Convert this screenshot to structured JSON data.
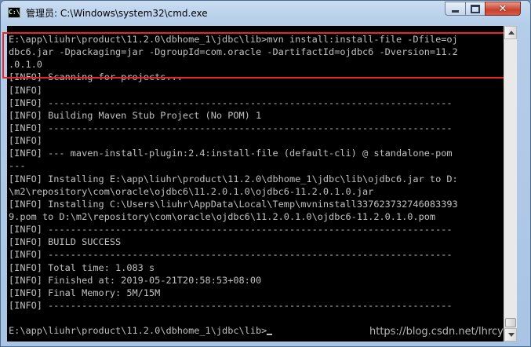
{
  "window": {
    "title": "管理员: C:\\Windows\\system32\\cmd.exe",
    "app_icon": "C:\\"
  },
  "console": {
    "lines": [
      "E:\\app\\liuhr\\product\\11.2.0\\dbhome_1\\jdbc\\lib>mvn install:install-file -Dfile=oj",
      "dbc6.jar -Dpackaging=jar -DgroupId=com.oracle -DartifactId=ojdbc6 -Dversion=11.2",
      ".0.1.0",
      "[INFO] Scanning for projects...",
      "[INFO]",
      "[INFO] ------------------------------------------------------------------------",
      "[INFO] Building Maven Stub Project (No POM) 1",
      "[INFO] ------------------------------------------------------------------------",
      "[INFO]",
      "[INFO] --- maven-install-plugin:2.4:install-file (default-cli) @ standalone-pom",
      "---",
      "[INFO] Installing E:\\app\\liuhr\\product\\11.2.0\\dbhome_1\\jdbc\\lib\\ojdbc6.jar to D:",
      "\\m2\\repository\\com\\oracle\\ojdbc6\\11.2.0.1.0\\ojdbc6-11.2.0.1.0.jar",
      "[INFO] Installing C:\\Users\\liuhr\\AppData\\Local\\Temp\\mvninstall337623732746083393",
      "9.pom to D:\\m2\\repository\\com\\oracle\\ojdbc6\\11.2.0.1.0\\ojdbc6-11.2.0.1.0.pom",
      "[INFO] ------------------------------------------------------------------------",
      "[INFO] BUILD SUCCESS",
      "[INFO] ------------------------------------------------------------------------",
      "[INFO] Total time: 1.083 s",
      "[INFO] Finished at: 2019-05-21T20:58:53+08:00",
      "[INFO] Final Memory: 5M/15M",
      "[INFO] ------------------------------------------------------------------------",
      "",
      "E:\\app\\liuhr\\product\\11.2.0\\dbhome_1\\jdbc\\lib>"
    ]
  },
  "watermark": "https://blog.csdn.net/lhrcy",
  "colors": {
    "console_bg": "#000000",
    "console_text": "#c0c0c0",
    "highlight_border": "#e8262a",
    "close_button": "#c8412e"
  },
  "icons": {
    "app": "cmd-icon",
    "minimize": "minimize-icon",
    "maximize": "maximize-icon",
    "close": "close-icon"
  }
}
